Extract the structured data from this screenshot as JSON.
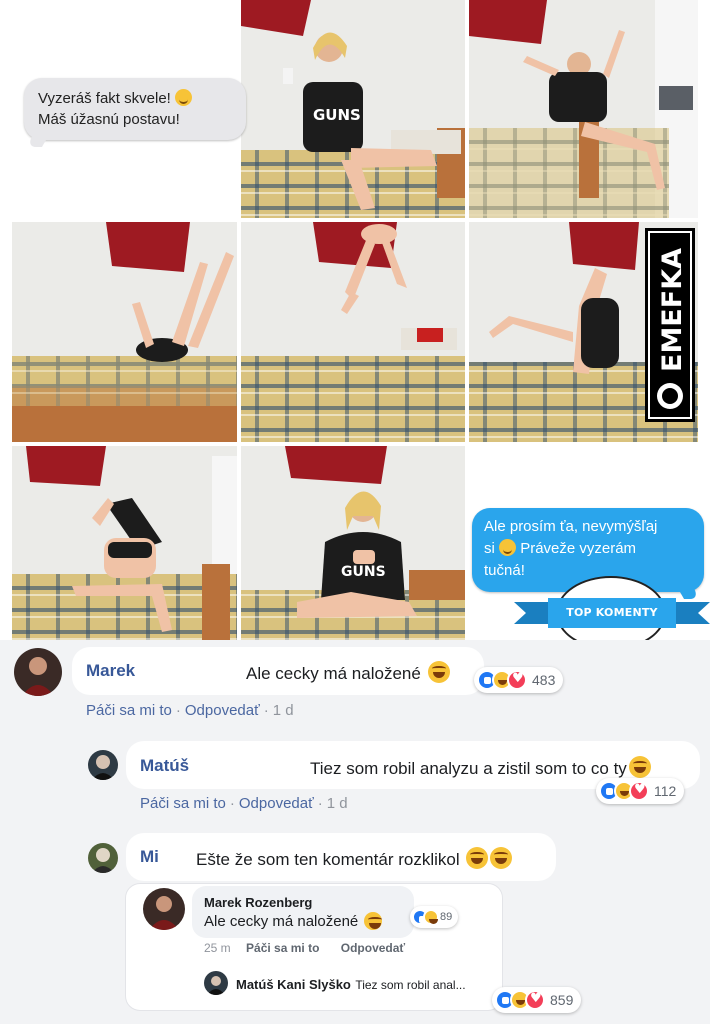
{
  "collage": {
    "bubble_left": {
      "line1": "Vyzeráš fakt skvele!",
      "line2": "Máš úžasnú postavu!"
    },
    "bubble_right": {
      "line1": "Ale prosím ťa, nevymýšľaj",
      "line2a": "si",
      "line2b": "Práveže vyzerám",
      "line3": "tučná!"
    },
    "watermark": "EMEFKA",
    "badge": "TOP KOMENTY",
    "shirt_text": "GUNS"
  },
  "comments": [
    {
      "name": "Marek",
      "text": "Ale cecky má naložené",
      "reactions": 483,
      "like": "Páči sa mi to",
      "reply": "Odpovedať",
      "time": "1 d"
    },
    {
      "name": "Matúš",
      "text": "Tiez som robil analyzu a zistil som to co ty",
      "reactions": 112,
      "like": "Páči sa mi to",
      "reply": "Odpovedať",
      "time": "1 d"
    },
    {
      "name": "Mi",
      "text": "Ešte že som ten komentár rozklikol",
      "reactions": 859,
      "nested": {
        "name": "Marek Rozenberg",
        "text": "Ale cecky má naložené",
        "reactions": 89,
        "time": "25 m",
        "like": "Páči sa mi to",
        "reply": "Odpovedať",
        "reply_name": "Matúš Kani Slyško",
        "reply_text": "Tiez som robil anal..."
      }
    }
  ]
}
